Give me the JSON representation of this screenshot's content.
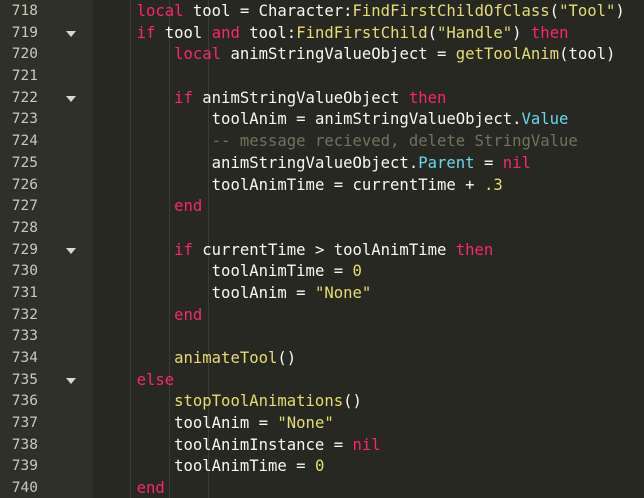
{
  "colors": {
    "background": "#272822",
    "gutter": "#2f3129",
    "keyword": "#f92672",
    "function": "#e6db74",
    "string": "#e6db74",
    "property": "#66d9ef",
    "comment": "#75715e",
    "text": "#f8f8f2"
  },
  "fold_icon": "chevron-down-icon",
  "lines": [
    {
      "n": "718",
      "fold": false,
      "indent": "    ",
      "t": [
        [
          "kw",
          "local"
        ],
        [
          "op",
          " tool = Character:"
        ],
        [
          "fn",
          "FindFirstChildOfClass"
        ],
        [
          "op",
          "("
        ],
        [
          "str",
          "\"Tool\""
        ],
        [
          "op",
          ")"
        ]
      ]
    },
    {
      "n": "719",
      "fold": true,
      "indent": "    ",
      "t": [
        [
          "kw",
          "if"
        ],
        [
          "op",
          " tool "
        ],
        [
          "kw",
          "and"
        ],
        [
          "op",
          " tool:"
        ],
        [
          "fn",
          "FindFirstChild"
        ],
        [
          "op",
          "("
        ],
        [
          "str",
          "\"Handle\""
        ],
        [
          "op",
          ") "
        ],
        [
          "kw",
          "then"
        ]
      ]
    },
    {
      "n": "720",
      "fold": false,
      "indent": "        ",
      "t": [
        [
          "kw",
          "local"
        ],
        [
          "op",
          " animStringValueObject = "
        ],
        [
          "fn",
          "getToolAnim"
        ],
        [
          "op",
          "(tool)"
        ]
      ]
    },
    {
      "n": "721",
      "fold": false,
      "indent": "",
      "t": []
    },
    {
      "n": "722",
      "fold": true,
      "indent": "        ",
      "t": [
        [
          "kw",
          "if"
        ],
        [
          "op",
          " animStringValueObject "
        ],
        [
          "kw",
          "then"
        ]
      ]
    },
    {
      "n": "723",
      "fold": false,
      "indent": "            ",
      "t": [
        [
          "op",
          "toolAnim = animStringValueObject."
        ],
        [
          "prop",
          "Value"
        ]
      ]
    },
    {
      "n": "724",
      "fold": false,
      "indent": "            ",
      "t": [
        [
          "cm",
          "-- message recieved, delete StringValue"
        ]
      ]
    },
    {
      "n": "725",
      "fold": false,
      "indent": "            ",
      "t": [
        [
          "op",
          "animStringValueObject."
        ],
        [
          "prop",
          "Parent"
        ],
        [
          "op",
          " = "
        ],
        [
          "kw",
          "nil"
        ]
      ]
    },
    {
      "n": "726",
      "fold": false,
      "indent": "            ",
      "t": [
        [
          "op",
          "toolAnimTime = currentTime + "
        ],
        [
          "num",
          ".3"
        ]
      ]
    },
    {
      "n": "727",
      "fold": false,
      "indent": "        ",
      "t": [
        [
          "kw",
          "end"
        ]
      ]
    },
    {
      "n": "728",
      "fold": false,
      "indent": "",
      "t": []
    },
    {
      "n": "729",
      "fold": true,
      "indent": "        ",
      "t": [
        [
          "kw",
          "if"
        ],
        [
          "op",
          " currentTime > toolAnimTime "
        ],
        [
          "kw",
          "then"
        ]
      ]
    },
    {
      "n": "730",
      "fold": false,
      "indent": "            ",
      "t": [
        [
          "op",
          "toolAnimTime = "
        ],
        [
          "num",
          "0"
        ]
      ]
    },
    {
      "n": "731",
      "fold": false,
      "indent": "            ",
      "t": [
        [
          "op",
          "toolAnim = "
        ],
        [
          "str",
          "\"None\""
        ]
      ]
    },
    {
      "n": "732",
      "fold": false,
      "indent": "        ",
      "t": [
        [
          "kw",
          "end"
        ]
      ]
    },
    {
      "n": "733",
      "fold": false,
      "indent": "",
      "t": []
    },
    {
      "n": "734",
      "fold": false,
      "indent": "        ",
      "t": [
        [
          "fn",
          "animateTool"
        ],
        [
          "op",
          "()"
        ]
      ]
    },
    {
      "n": "735",
      "fold": true,
      "indent": "    ",
      "t": [
        [
          "kw",
          "else"
        ]
      ]
    },
    {
      "n": "736",
      "fold": false,
      "indent": "        ",
      "t": [
        [
          "fn",
          "stopToolAnimations"
        ],
        [
          "op",
          "()"
        ]
      ]
    },
    {
      "n": "737",
      "fold": false,
      "indent": "        ",
      "t": [
        [
          "op",
          "toolAnim = "
        ],
        [
          "str",
          "\"None\""
        ]
      ]
    },
    {
      "n": "738",
      "fold": false,
      "indent": "        ",
      "t": [
        [
          "op",
          "toolAnimInstance = "
        ],
        [
          "kw",
          "nil"
        ]
      ]
    },
    {
      "n": "739",
      "fold": false,
      "indent": "        ",
      "t": [
        [
          "op",
          "toolAnimTime = "
        ],
        [
          "num",
          "0"
        ]
      ]
    },
    {
      "n": "740",
      "fold": false,
      "indent": "    ",
      "t": [
        [
          "kw",
          "end"
        ]
      ]
    }
  ]
}
